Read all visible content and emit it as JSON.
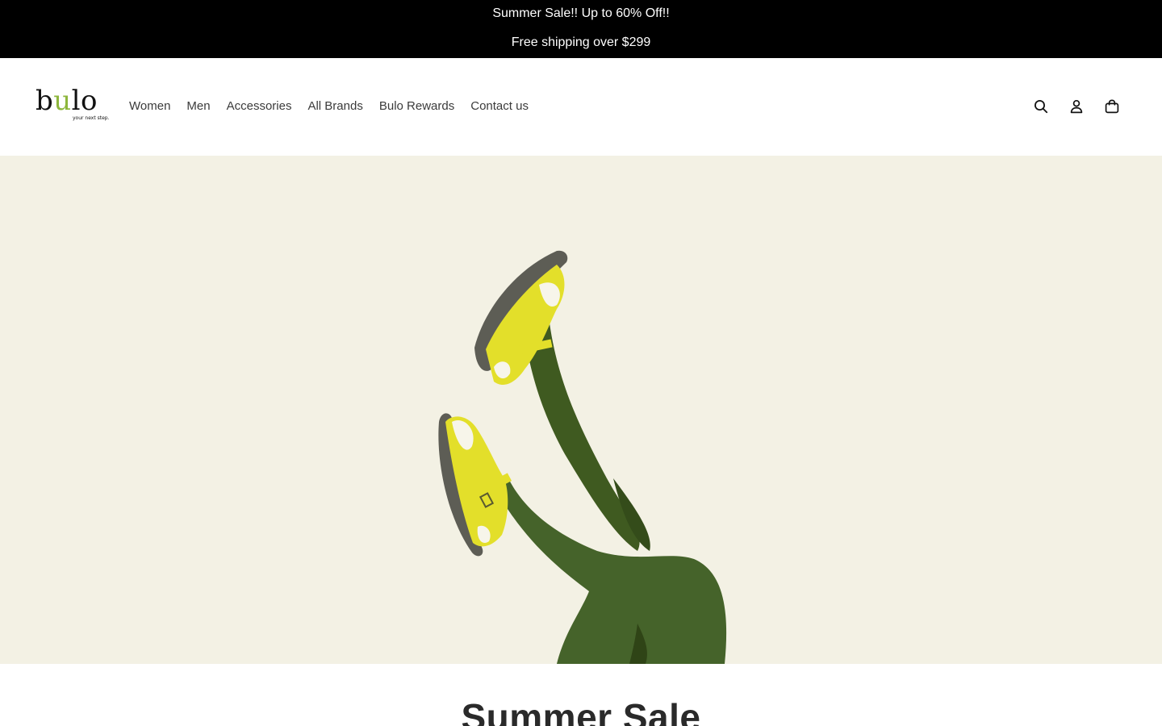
{
  "announcement": {
    "line1": "Summer Sale!! Up to 60% Off!!",
    "line2": "Free shipping over $299"
  },
  "logo": {
    "word_b": "b",
    "word_u": "u",
    "word_lo": "lo",
    "tagline": "your next step."
  },
  "nav": {
    "items": [
      "Women",
      "Men",
      "Accessories",
      "All Brands",
      "Bulo Rewards",
      "Contact us"
    ]
  },
  "header_icons": [
    "search-icon",
    "account-icon",
    "cart-icon"
  ],
  "hero": {
    "background": "#f3f1e4",
    "image": "legs-in-green-tights-with-yellow-sandals"
  },
  "section": {
    "title": "Summer Sale"
  },
  "colors": {
    "announcement_bg": "#000000",
    "logo_accent": "#8db63c",
    "tights": "#3f5a20",
    "sandal": "#e3df2a"
  }
}
